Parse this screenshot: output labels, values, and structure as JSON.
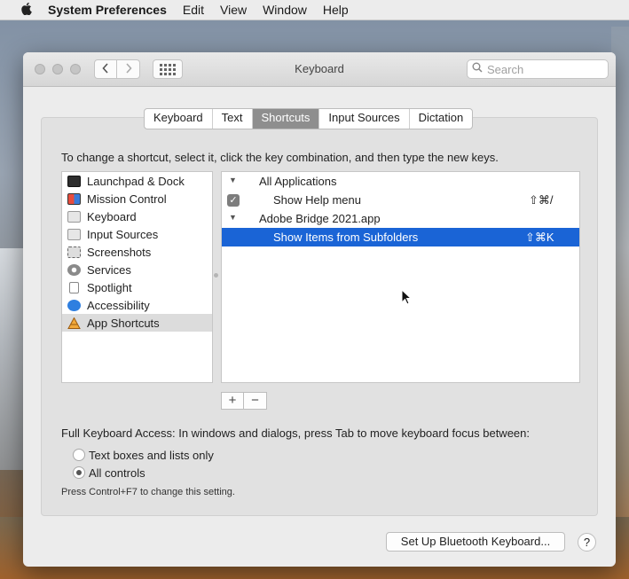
{
  "menubar": {
    "apple_icon": "apple-logo-icon",
    "app_name": "System Preferences",
    "items": [
      "Edit",
      "View",
      "Window",
      "Help"
    ]
  },
  "window": {
    "title": "Keyboard",
    "back_icon": "chevron-left-icon",
    "forward_icon": "chevron-right-icon",
    "show_all_icon": "grid-icon",
    "search": {
      "placeholder": "Search",
      "value": ""
    }
  },
  "tabs": [
    {
      "label": "Keyboard",
      "active": false
    },
    {
      "label": "Text",
      "active": false
    },
    {
      "label": "Shortcuts",
      "active": true
    },
    {
      "label": "Input Sources",
      "active": false
    },
    {
      "label": "Dictation",
      "active": false
    }
  ],
  "instruction": "To change a shortcut, select it, click the key combination, and then type the new keys.",
  "categories": [
    {
      "label": "Launchpad & Dock",
      "icon": "launchpad-icon",
      "selected": false
    },
    {
      "label": "Mission Control",
      "icon": "mission-control-icon",
      "selected": false
    },
    {
      "label": "Keyboard",
      "icon": "keyboard-icon",
      "selected": false
    },
    {
      "label": "Input Sources",
      "icon": "input-sources-icon",
      "selected": false
    },
    {
      "label": "Screenshots",
      "icon": "screenshots-icon",
      "selected": false
    },
    {
      "label": "Services",
      "icon": "services-gear-icon",
      "selected": false
    },
    {
      "label": "Spotlight",
      "icon": "spotlight-icon",
      "selected": false
    },
    {
      "label": "Accessibility",
      "icon": "accessibility-icon",
      "selected": false
    },
    {
      "label": "App Shortcuts",
      "icon": "app-shortcuts-icon",
      "selected": true
    }
  ],
  "shortcuts": [
    {
      "label": "All Applications",
      "group": true,
      "key": ""
    },
    {
      "label": "Show Help menu",
      "group": false,
      "checked": true,
      "key": "⇧⌘/"
    },
    {
      "label": "Adobe Bridge 2021.app",
      "group": true,
      "key": ""
    },
    {
      "label": "Show Items from Subfolders",
      "group": false,
      "selected": true,
      "key": "⇧⌘K"
    }
  ],
  "add_label": "+",
  "remove_label": "−",
  "full_keyboard_access": "Full Keyboard Access: In windows and dialogs, press Tab to move keyboard focus between:",
  "radio_options": [
    {
      "label": "Text boxes and lists only",
      "selected": false
    },
    {
      "label": "All controls",
      "selected": true
    }
  ],
  "note": "Press Control+F7 to change this setting.",
  "bluetooth_button": "Set Up Bluetooth Keyboard...",
  "help_label": "?",
  "colors": {
    "selection": "#1a64d6",
    "active_tab": "#8e8e8e"
  }
}
